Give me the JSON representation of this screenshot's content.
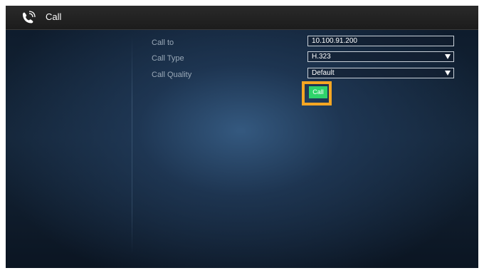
{
  "header": {
    "title": "Call",
    "icon": "phone-call-icon"
  },
  "form": {
    "call_to_label": "Call to",
    "call_to_value": "10.100.91.200",
    "call_type_label": "Call Type",
    "call_type_value": "H.323",
    "call_quality_label": "Call Quality",
    "call_quality_value": "Default",
    "call_button_label": "Call"
  },
  "colors": {
    "accent_green": "#2fd36b",
    "highlight_orange": "#f5a623"
  }
}
